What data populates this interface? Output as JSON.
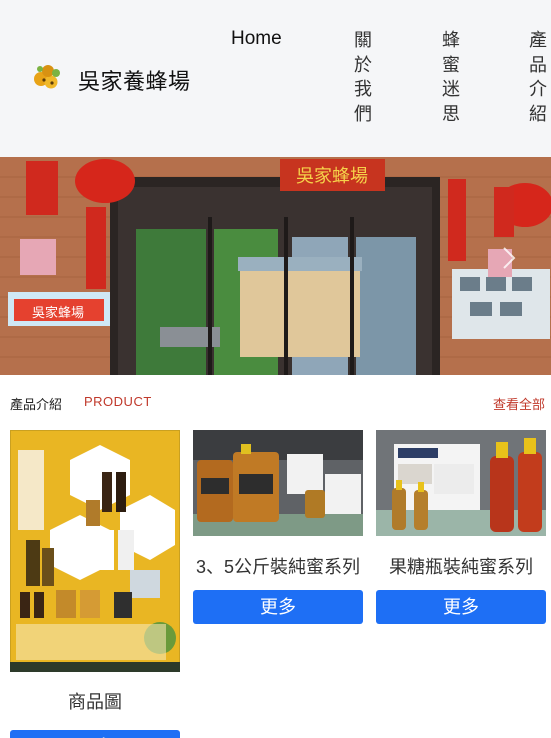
{
  "header": {
    "brand": "吳家養蜂場",
    "nav": [
      {
        "label": "Home"
      },
      {
        "label": "關於我們"
      },
      {
        "label": "蜂蜜迷思"
      },
      {
        "label": "產品介紹"
      }
    ]
  },
  "banner": {
    "sign_text": "吳家蜂場",
    "board_text": "吳家蜂場"
  },
  "products_section": {
    "title": "產品介紹",
    "subtitle": "PRODUCT",
    "view_all": "查看全部"
  },
  "products": [
    {
      "name": "商品圖",
      "button": "更多"
    },
    {
      "name": "3、5公斤裝純蜜系列",
      "button": "更多"
    },
    {
      "name": "果糖瓶裝純蜜系列",
      "button": "更多"
    }
  ],
  "colors": {
    "accent": "#c0392b",
    "button": "#1e6ff5",
    "header_bg": "#f5f6f8"
  }
}
